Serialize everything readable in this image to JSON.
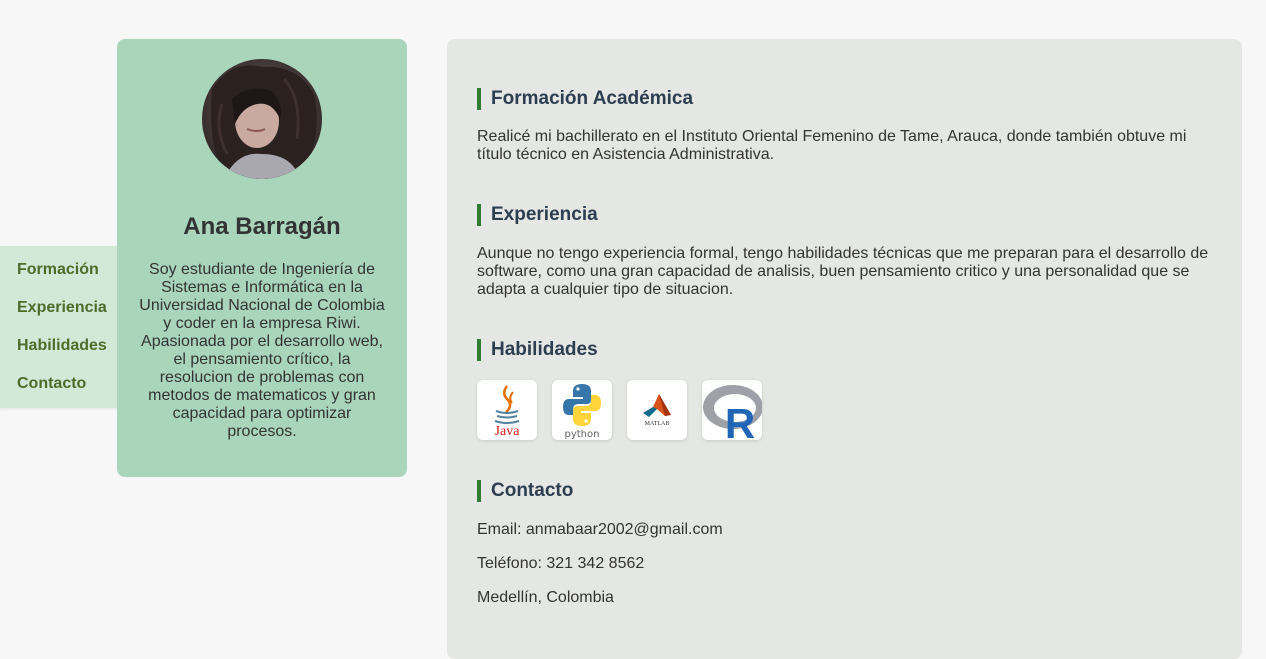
{
  "nav": {
    "items": [
      {
        "label": "Formación"
      },
      {
        "label": "Experiencia"
      },
      {
        "label": "Habilidades"
      },
      {
        "label": "Contacto"
      }
    ]
  },
  "profile": {
    "name": "Ana Barragán",
    "bio": "Soy estudiante de Ingeniería de Sistemas e Informática en la Universidad Nacional de Colombia y coder en la empresa Riwi. Apasionada por el desarrollo web, el pensamiento crítico, la resolucion de problemas con metodos de matematicos y gran capacidad para optimizar procesos."
  },
  "sections": {
    "formacion": {
      "title": "Formación Académica",
      "text": "Realicé mi bachillerato en el Instituto Oriental Femenino de Tame, Arauca, donde también obtuve mi título técnico en Asistencia Administrativa."
    },
    "experiencia": {
      "title": "Experiencia",
      "text": "Aunque no tengo experiencia formal, tengo habilidades técnicas que me preparan para el desarrollo de software, como una gran capacidad de analisis, buen pensamiento critico y una personalidad que se adapta a cualquier tipo de situacion."
    },
    "habilidades": {
      "title": "Habilidades",
      "skills": [
        {
          "label": "Java",
          "icon": "java-logo-icon"
        },
        {
          "label": "python",
          "icon": "python-logo-icon"
        },
        {
          "label": "MATLAB",
          "icon": "matlab-logo-icon"
        },
        {
          "label": "R",
          "icon": "r-logo-icon"
        }
      ]
    },
    "contacto": {
      "title": "Contacto",
      "email": "Email: anmabaar2002@gmail.com",
      "phone": "Teléfono: 321 342 8562",
      "location": "Medellín, Colombia"
    }
  },
  "colors": {
    "accent": "#2e7d32",
    "nav_bg": "#d3e9d8",
    "profile_bg": "#a9d5bb",
    "content_bg": "#e5e7e4"
  }
}
